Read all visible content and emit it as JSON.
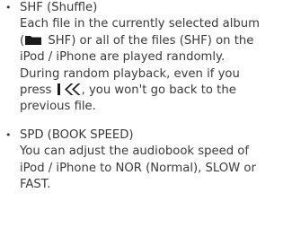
{
  "items": [
    {
      "bullet": "•",
      "title": "SHF (Shuffle)",
      "line1": "Each file in the currently selected album",
      "line2_open": "(",
      "line2_rest": " SHF) or all of the files (SHF) on the",
      "line3": "iPod / iPhone are played randomly.",
      "line4": "During random playback, even if you",
      "line5_start": "press ",
      "line5_end": ", you won't go back to the",
      "line6": "previous file."
    },
    {
      "bullet": "•",
      "title": "SPD (BOOK SPEED)",
      "line1": "You can adjust the audiobook speed of",
      "line2": "iPod / iPhone to NOR (Normal), SLOW or",
      "line3": "FAST."
    }
  ],
  "icons": {
    "album": "folder-icon",
    "previous": "skip-previous-icon"
  },
  "colors": {
    "text": "#3a3a3a",
    "icon": "#1a1a1a"
  }
}
